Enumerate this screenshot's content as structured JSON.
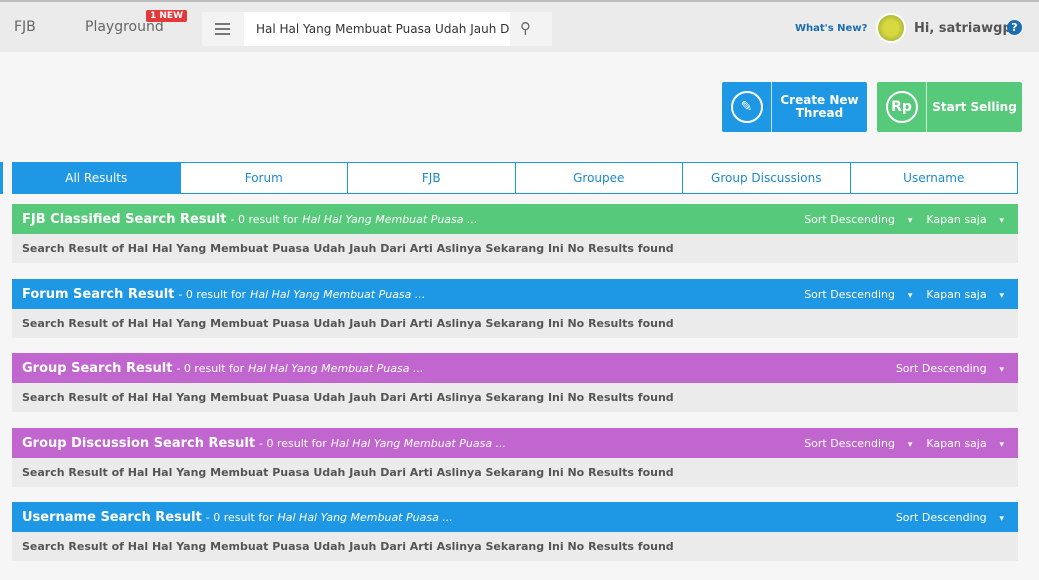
{
  "header": {
    "nav": [
      "FJB",
      "Playground"
    ],
    "badge": "1 NEW",
    "search_value": "Hal Hal Yang Membuat Puasa Udah Jauh Dari",
    "whats_new": "What's New?",
    "greeting": "Hi, satriawgp",
    "help": "?"
  },
  "actions": {
    "create": "Create New Thread",
    "sell": "Start Selling",
    "sell_icon": "Rp"
  },
  "tabs": [
    "All Results",
    "Forum",
    "FJB",
    "Groupee",
    "Group Discussions",
    "Username"
  ],
  "colors": {
    "green": "#57c97a",
    "blue": "#1e98e4",
    "purple": "#c266cf"
  },
  "sections": [
    {
      "title": "FJB Classified Search Result",
      "count": "- 0 result for",
      "query": "Hal Hal Yang Membuat Puasa ...",
      "sort": "Sort Descending",
      "time": "Kapan saja",
      "body": "Search Result of Hal Hal Yang Membuat Puasa Udah Jauh Dari Arti Aslinya Sekarang Ini No Results found"
    },
    {
      "title": "Forum Search Result",
      "count": "- 0 result for",
      "query": "Hal Hal Yang Membuat Puasa ...",
      "sort": "Sort Descending",
      "time": "Kapan saja",
      "body": "Search Result of Hal Hal Yang Membuat Puasa Udah Jauh Dari Arti Aslinya Sekarang Ini No Results found"
    },
    {
      "title": "Group Search Result",
      "count": "- 0 result for",
      "query": "Hal Hal Yang Membuat Puasa ...",
      "sort": "Sort Descending",
      "body": "Search Result of Hal Hal Yang Membuat Puasa Udah Jauh Dari Arti Aslinya Sekarang Ini No Results found"
    },
    {
      "title": "Group Discussion Search Result",
      "count": "- 0 result for",
      "query": "Hal Hal Yang Membuat Puasa ...",
      "sort": "Sort Descending",
      "time": "Kapan saja",
      "body": "Search Result of Hal Hal Yang Membuat Puasa Udah Jauh Dari Arti Aslinya Sekarang Ini No Results found"
    },
    {
      "title": "Username Search Result",
      "count": "- 0 result for",
      "query": "Hal Hal Yang Membuat Puasa ...",
      "sort": "Sort Descending",
      "body": "Search Result of Hal Hal Yang Membuat Puasa Udah Jauh Dari Arti Aslinya Sekarang Ini No Results found"
    }
  ]
}
